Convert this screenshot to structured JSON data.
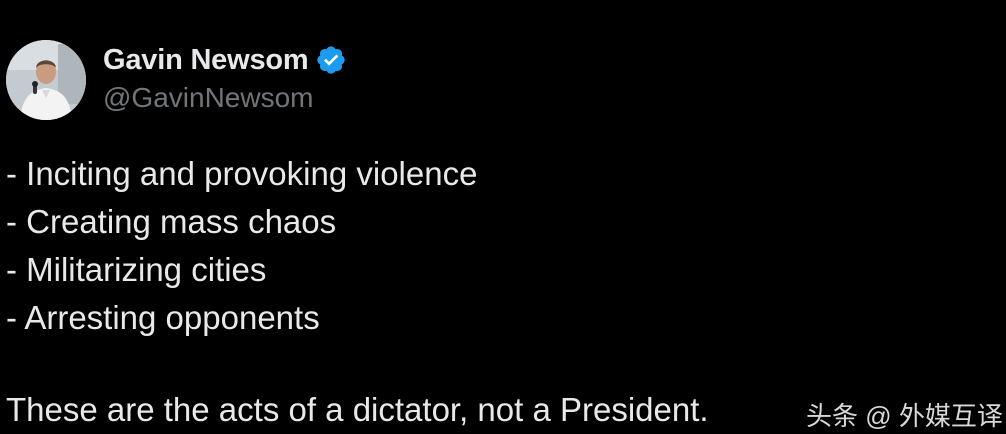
{
  "post": {
    "author": {
      "display_name": "Gavin Newsom",
      "handle": "@GavinNewsom",
      "verified": true
    },
    "lines": [
      "- Inciting and provoking violence",
      "- Creating mass chaos",
      "- Militarizing cities",
      "- Arresting opponents"
    ],
    "closing_line": "These are the acts of a dictator, not a President."
  },
  "watermark": "头条 @ 外媒互译",
  "colors": {
    "background": "#000000",
    "text_primary": "#e7e9ea",
    "text_secondary": "#71767b",
    "verified_blue": "#1d9bf0"
  },
  "icons": {
    "verified": "verified-badge-icon"
  }
}
